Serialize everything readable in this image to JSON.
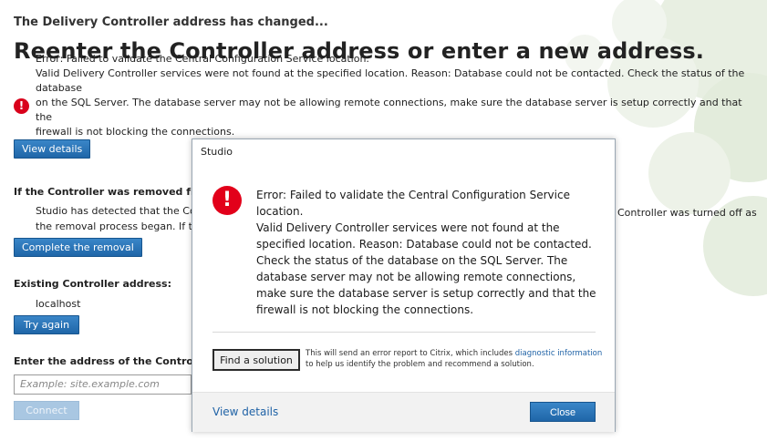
{
  "page": {
    "subtitle": "The Delivery Controller address has changed...",
    "title": "Reenter the Controller address or enter a new address.",
    "error": {
      "line1": "Error: Failed to validate the Central Configuration Service location.",
      "line2": "Valid Delivery Controller services were not found at the specified location. Reason: Database could not be contacted. Check the status of the database",
      "line3": "on the SQL Server. The database server may not be allowing remote connections, make sure the database server is setup correctly and that the",
      "line4": "firewall is not blocking the connections."
    },
    "view_details_button": "View details",
    "removed_section": {
      "heading": "If the Controller was removed from",
      "text_line1_left": "Studio has detected that the Con",
      "text_line1_right": "Controller was turned off as",
      "text_line2_left": "the removal process began. If th",
      "button": "Complete the removal"
    },
    "existing_section": {
      "heading": "Existing Controller address:",
      "value": "localhost",
      "button": "Try again"
    },
    "enter_section": {
      "heading": "Enter the address of the Controller y",
      "placeholder": "Example: site.example.com",
      "button": "Connect"
    }
  },
  "dialog": {
    "title": "Studio",
    "message_lines": [
      "Error: Failed to validate the Central Configuration Service",
      "location.",
      "Valid Delivery Controller services were not found at the",
      "specified location. Reason: Database could not be contacted.",
      "Check the status of the database on the SQL Server. The",
      "database server may not be allowing remote connections,",
      "make sure the database server is setup correctly and that the",
      "firewall is not blocking the connections."
    ],
    "find_button": "Find a solution",
    "find_note_prefix": "This will send an error report to Citrix, which includes",
    "find_note_link": "diagnostic information",
    "find_note_suffix": "to help us identify the problem and recommend a solution.",
    "footer_link": "View details",
    "close_button": "Close"
  },
  "icons": {
    "error": "error-icon",
    "background": "decorative-circles"
  },
  "colors": {
    "accent_blue": "#1f66a8",
    "error_red": "#d9001b",
    "link_blue": "#1f62a6"
  }
}
